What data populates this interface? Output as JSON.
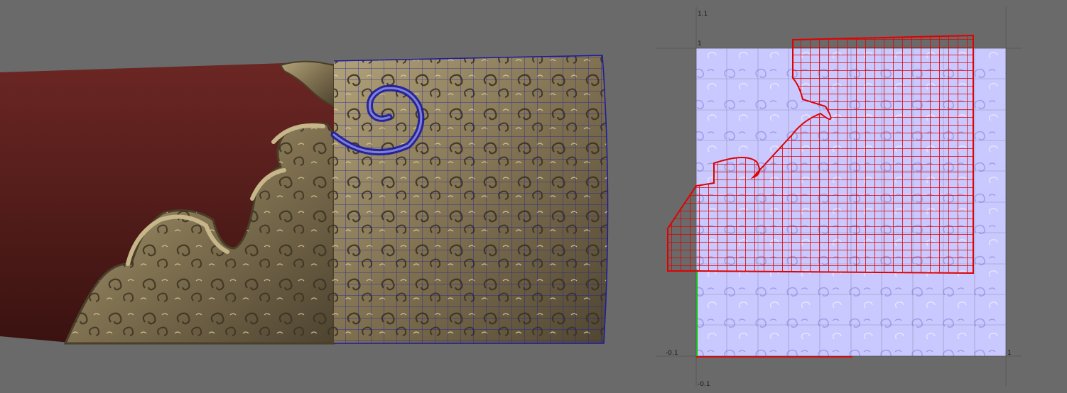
{
  "viewport": {
    "shading_colors": {
      "background": "#6a6a6a",
      "scabbard": "#5a201d",
      "metal": "#8e7f5c",
      "wireframe": "#1b1b9e"
    }
  },
  "uv_editor": {
    "axis_labels": {
      "top_left": "1.1",
      "u_one_v_one": "1",
      "left_neg": "-0.1",
      "right_one": "1",
      "bottom_neg": "-0.1"
    },
    "colors": {
      "texture": "#c9c9ff",
      "uv_shell": "#e00000",
      "grid_line": "#555555",
      "u_axis": "#d01010",
      "v_axis": "#10c010"
    }
  }
}
